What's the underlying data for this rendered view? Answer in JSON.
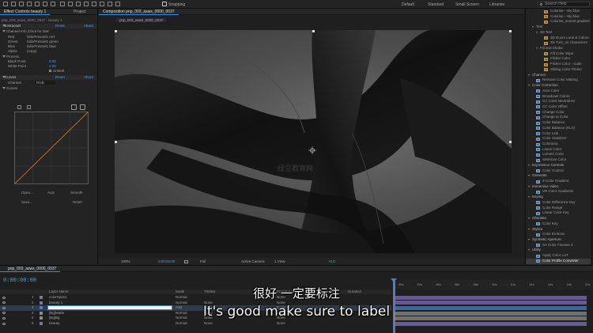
{
  "toolbar": {
    "snapping_label": "Snapping",
    "workspaces": [
      "Default",
      "Standard",
      "Small Screen",
      "Libraries"
    ],
    "search_placeholder": "Search Help"
  },
  "effect_controls": {
    "tab_label": "Effect Controls beauty 1",
    "tab_project": "Project",
    "layer_path": "pnp_003_asws_0000_0037 · beauty 1",
    "effect_name": "EXtractoR",
    "reset_label": "Reset",
    "about_label": "About",
    "channel_info_label": "Channel Info (Click for Dial",
    "channels": [
      {
        "name": "Red",
        "value": "falin/Fresnel1 red"
      },
      {
        "name": "Green",
        "value": "falin/Fresnel1 green"
      },
      {
        "name": "Blue",
        "value": "falin/Fresnel1 blue"
      },
      {
        "name": "Alpha",
        "value": "(copy)"
      }
    ],
    "process_label": "Process",
    "black_point_label": "Black Point",
    "black_point_value": "0.00",
    "white_point_label": "White Point",
    "white_point_value": "1.00",
    "unmult_label": "UnMult",
    "curves_effect": "Curves",
    "curves_reset": "Reset",
    "curves_about": "About",
    "channel_label": "Channel",
    "channel_value": "RGB",
    "curves_sub": "Curves",
    "btn_open": "Open...",
    "btn_auto": "Auto",
    "btn_smooth": "Smooth",
    "btn_save": "Save...",
    "btn_reset": "Reset"
  },
  "composition": {
    "tab_label": "Composition pnp_003_asws_0000_0037",
    "sub_tab": "pnp_003_asws_0000_0037",
    "watermark": "绿豆教育网",
    "footer": {
      "zoom": "100%",
      "timecode": "0:00:00:00",
      "resolution": "Full",
      "camera": "Active Camera",
      "views": "1 View",
      "exposure": "+0.0"
    }
  },
  "effects_panel": {
    "items": [
      {
        "label": "Colorise - sky blue",
        "kind": "preset",
        "indent": 3
      },
      {
        "label": "Colorise - sky blue",
        "kind": "preset",
        "indent": 3
      },
      {
        "label": "Colorise_sunset gradient",
        "kind": "preset",
        "indent": 3
      },
      {
        "label": "Text",
        "kind": "folder",
        "indent": 1
      },
      {
        "label": "3D Text",
        "kind": "folder",
        "indent": 2
      },
      {
        "label": "3D Room Look & Colors",
        "kind": "preset",
        "indent": 3
      },
      {
        "label": "3D Turn_on Characters",
        "kind": "preset",
        "indent": 3
      },
      {
        "label": "Fill and Stroke",
        "kind": "folder",
        "indent": 2
      },
      {
        "label": "Fill Color Wipe",
        "kind": "preset",
        "indent": 3
      },
      {
        "label": "Flicker Color",
        "kind": "preset",
        "indent": 3
      },
      {
        "label": "Flicker Color - scale",
        "kind": "preset",
        "indent": 3
      },
      {
        "label": "Sliding Color Flicker",
        "kind": "preset",
        "indent": 3
      },
      {
        "label": "Channel",
        "kind": "category",
        "indent": 0
      },
      {
        "label": "Remove Color Matting",
        "kind": "effect",
        "indent": 1
      },
      {
        "label": "Color Correction",
        "kind": "category",
        "indent": 0
      },
      {
        "label": "Auto Color",
        "kind": "effect",
        "indent": 1
      },
      {
        "label": "Broadcast Colors",
        "kind": "effect",
        "indent": 1
      },
      {
        "label": "CC Color Neutralizer",
        "kind": "effect",
        "indent": 1
      },
      {
        "label": "CC Color Offset",
        "kind": "effect",
        "indent": 1
      },
      {
        "label": "Change Color",
        "kind": "effect",
        "indent": 1
      },
      {
        "label": "Change to Color",
        "kind": "effect",
        "indent": 1
      },
      {
        "label": "Color Balance",
        "kind": "effect",
        "indent": 1
      },
      {
        "label": "Color Balance (HLS)",
        "kind": "effect",
        "indent": 1
      },
      {
        "label": "Color Link",
        "kind": "effect",
        "indent": 1
      },
      {
        "label": "Color Stabilizer",
        "kind": "effect",
        "indent": 1
      },
      {
        "label": "Colorama",
        "kind": "effect",
        "indent": 1
      },
      {
        "label": "Leave Color",
        "kind": "effect",
        "indent": 1
      },
      {
        "label": "Lumetri Color",
        "kind": "effect",
        "indent": 1
      },
      {
        "label": "Selective Color",
        "kind": "effect",
        "indent": 1
      },
      {
        "label": "Expression Controls",
        "kind": "category",
        "indent": 0
      },
      {
        "label": "Color Control",
        "kind": "effect",
        "indent": 1
      },
      {
        "label": "Generate",
        "kind": "category",
        "indent": 0
      },
      {
        "label": "4-Color Gradient",
        "kind": "effect",
        "indent": 1
      },
      {
        "label": "Immersive Video",
        "kind": "category",
        "indent": 0
      },
      {
        "label": "VR Color Gradients",
        "kind": "effect",
        "indent": 1
      },
      {
        "label": "Keying",
        "kind": "category",
        "indent": 0
      },
      {
        "label": "Color Difference Key",
        "kind": "effect",
        "indent": 1
      },
      {
        "label": "Color Range",
        "kind": "effect",
        "indent": 1
      },
      {
        "label": "Linear Color Key",
        "kind": "effect",
        "indent": 1
      },
      {
        "label": "Obsolete",
        "kind": "category",
        "indent": 0
      },
      {
        "label": "Color Key",
        "kind": "effect",
        "indent": 1
      },
      {
        "label": "Stylize",
        "kind": "category",
        "indent": 0
      },
      {
        "label": "Color Emboss",
        "kind": "effect",
        "indent": 1
      },
      {
        "label": "Synthetic Aperture",
        "kind": "category",
        "indent": 0
      },
      {
        "label": "SA Color Finesse 3",
        "kind": "effect",
        "indent": 1
      },
      {
        "label": "Utility",
        "kind": "category",
        "indent": 0
      },
      {
        "label": "Apply Color LUT",
        "kind": "effect",
        "indent": 1
      },
      {
        "label": "Color Profile Converter",
        "kind": "effect",
        "indent": 1,
        "selected": true
      }
    ]
  },
  "timeline": {
    "tab_label": "pnp_003_asws_0000_0037",
    "timecode": "0:00:00:00",
    "columns": {
      "layer_name": "Layer Name",
      "mode": "Mode",
      "trkmat": "TrkMat",
      "parent": "Parent & Link",
      "in": "In",
      "duration": "Duration"
    },
    "layers": [
      {
        "num": "1",
        "name": "colorSpace",
        "mode": "Normal",
        "trkmat": "",
        "parent": "None",
        "color": "#7f6fb4"
      },
      {
        "num": "2",
        "name": "beauty 1",
        "mode": "Normal",
        "trkmat": "None",
        "parent": "None",
        "color": "#7f6fb4"
      },
      {
        "num": "3",
        "name": "",
        "mode": "Add",
        "trkmat": "None",
        "parent": "None",
        "color": "#4a7fc1",
        "editing": true
      },
      {
        "num": "4",
        "name": "[Bg]Matte",
        "mode": "Normal",
        "trkmat": "None",
        "parent": "None",
        "color": "#8c8c8c"
      },
      {
        "num": "5",
        "name": "[Bg]Bg",
        "mode": "Normal",
        "trkmat": "None",
        "parent": "None",
        "color": "#8c8c8c"
      },
      {
        "num": "6",
        "name": "beauty",
        "mode": "Normal",
        "trkmat": "None",
        "parent": "None",
        "color": "#7f6fb4"
      }
    ],
    "ruler": [
      "00s",
      "02s",
      "04s",
      "06s",
      "08s",
      "10s",
      "12s",
      "14s",
      "16s",
      "18s",
      "20s"
    ]
  },
  "subtitles": {
    "zh": "很好 一定要标注",
    "en": "It's good make sure to label"
  },
  "colors": {
    "accent": "#2d8ceb",
    "value_blue": "#4a9eff",
    "playhead": "#4a7fc1"
  }
}
